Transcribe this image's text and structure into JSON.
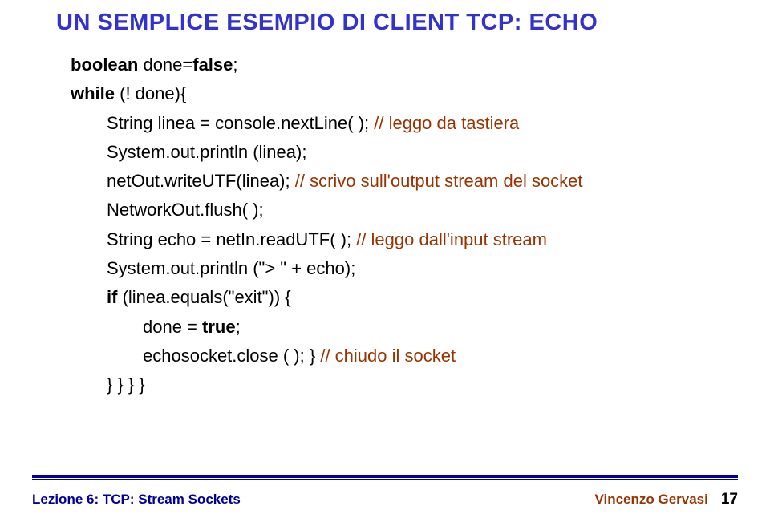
{
  "title": "UN SEMPLICE ESEMPIO DI CLIENT TCP: ECHO",
  "code": {
    "l1a": "boolean",
    "l1b": " done=",
    "l1c": "false",
    "l1d": ";",
    "l2a": "while",
    "l2b": " (! done){",
    "l3a": "String linea = console.nextLine( );   ",
    "l3b": "// leggo da tastiera",
    "l4": "System.out.println (linea);",
    "l5a": "netOut.writeUTF(linea);   ",
    "l5b": "// scrivo sull'output stream del socket",
    "l6": "NetworkOut.flush( );",
    "l7a": "String echo = netIn.readUTF( );  ",
    "l7b": "// leggo dall'input stream",
    "l8": "System.out.println (\"> \" + echo);",
    "l9a": "if",
    "l9b": "  (linea.equals(\"exit\")) {",
    "l10a": "done = ",
    "l10b": "true",
    "l10c": ";",
    "l11a": "echosocket.close ( ); }   ",
    "l11b": "//  chiudo il socket",
    "l12": "} } } }"
  },
  "footer": {
    "left": "Lezione 6: TCP: Stream Sockets",
    "author": "Vincenzo Gervasi",
    "page": "17"
  }
}
